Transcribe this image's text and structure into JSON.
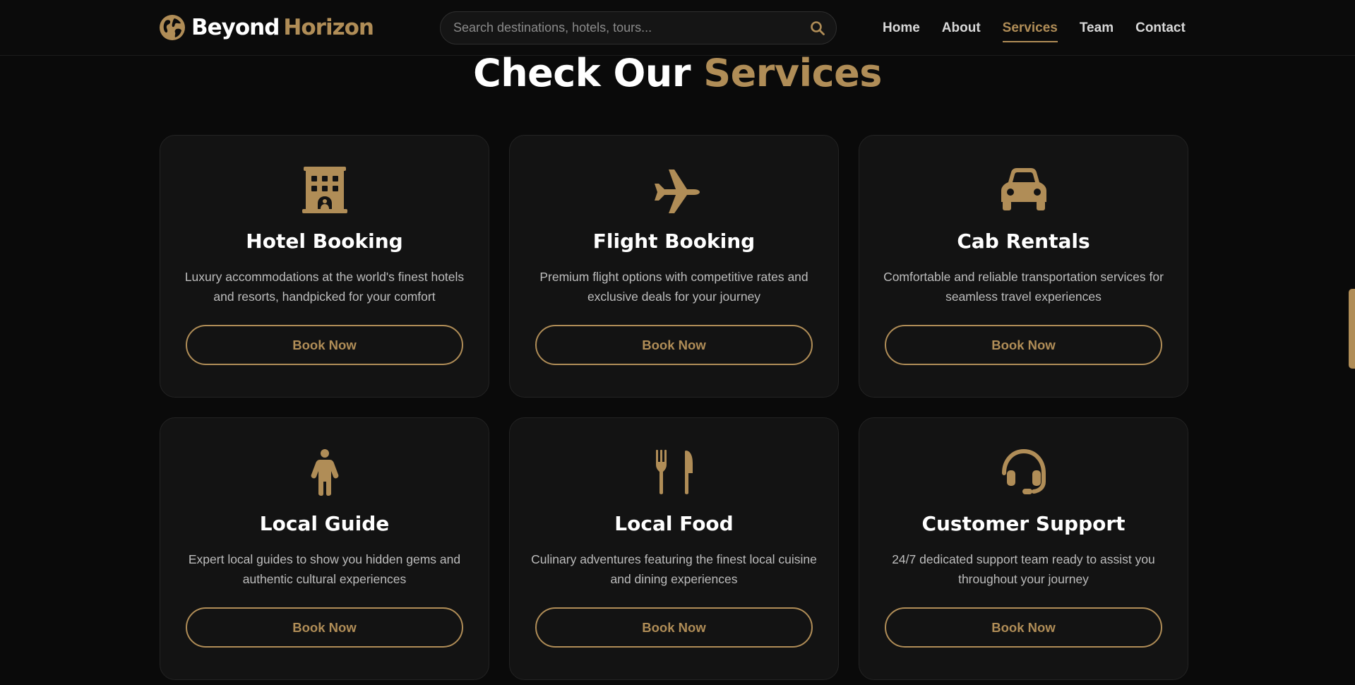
{
  "brand": {
    "word1": "Beyond",
    "word2": "Horizon",
    "icon": "globe-icon",
    "accent_color": "#b08d57"
  },
  "search": {
    "placeholder": "Search destinations, hotels, tours...",
    "value": "",
    "icon": "search-icon"
  },
  "nav": {
    "items": [
      {
        "label": "Home",
        "active": false
      },
      {
        "label": "About",
        "active": false
      },
      {
        "label": "Services",
        "active": true
      },
      {
        "label": "Team",
        "active": false
      },
      {
        "label": "Contact",
        "active": false
      }
    ]
  },
  "section": {
    "title_part1": "Check Our",
    "title_part2": "Services"
  },
  "services": [
    {
      "icon": "hotel-icon",
      "title": "Hotel Booking",
      "description": "Luxury accommodations at the world's finest hotels and resorts, handpicked for your comfort",
      "button": "Book Now"
    },
    {
      "icon": "plane-icon",
      "title": "Flight Booking",
      "description": "Premium flight options with competitive rates and exclusive deals for your journey",
      "button": "Book Now"
    },
    {
      "icon": "car-icon",
      "title": "Cab Rentals",
      "description": "Comfortable and reliable transportation services for seamless travel experiences",
      "button": "Book Now"
    },
    {
      "icon": "person-icon",
      "title": "Local Guide",
      "description": "Expert local guides to show you hidden gems and authentic cultural experiences",
      "button": "Book Now"
    },
    {
      "icon": "utensils-icon",
      "title": "Local Food",
      "description": "Culinary adventures featuring the finest local cuisine and dining experiences",
      "button": "Book Now"
    },
    {
      "icon": "headset-icon",
      "title": "Customer Support",
      "description": "24/7 dedicated support team ready to assist you throughout your journey",
      "button": "Book Now"
    }
  ]
}
